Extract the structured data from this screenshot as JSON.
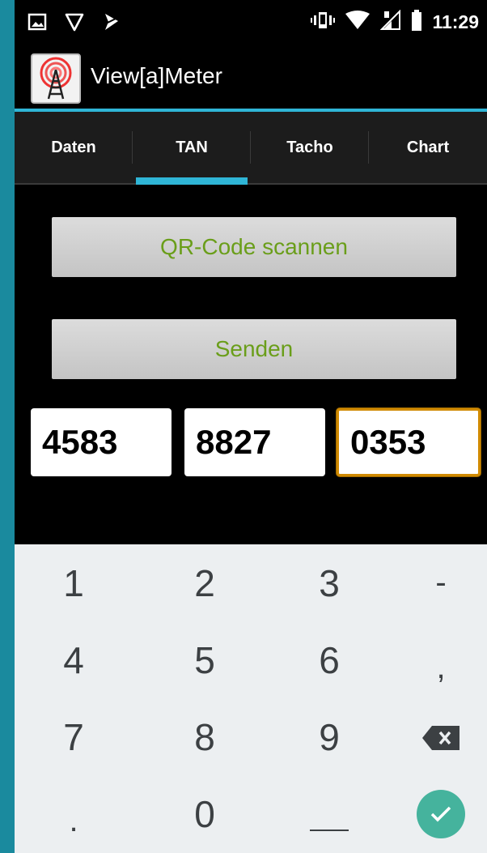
{
  "status_bar": {
    "time": "11:29",
    "icons": [
      "image-icon",
      "shield-icon",
      "nosound-icon",
      "vibrate-icon",
      "wifi-icon",
      "signal-icon",
      "battery-icon"
    ]
  },
  "app": {
    "title": "View[a]Meter",
    "accent_color": "#2fb5d6"
  },
  "tabs": [
    {
      "label": "Daten",
      "active": false
    },
    {
      "label": "TAN",
      "active": true
    },
    {
      "label": "Tacho",
      "active": false
    },
    {
      "label": "Chart",
      "active": false
    }
  ],
  "buttons": {
    "scan_label": "QR-Code scannen",
    "send_label": "Senden",
    "text_color": "#6a9e1a"
  },
  "tan_fields": [
    "4583",
    "8827",
    "0353"
  ],
  "keyboard": {
    "rows": [
      [
        "1",
        "2",
        "3",
        "-"
      ],
      [
        "4",
        "5",
        "6",
        ","
      ],
      [
        "7",
        "8",
        "9",
        "backspace"
      ],
      [
        ".",
        "0",
        "_",
        "done"
      ]
    ],
    "done_color": "#45b39d"
  }
}
